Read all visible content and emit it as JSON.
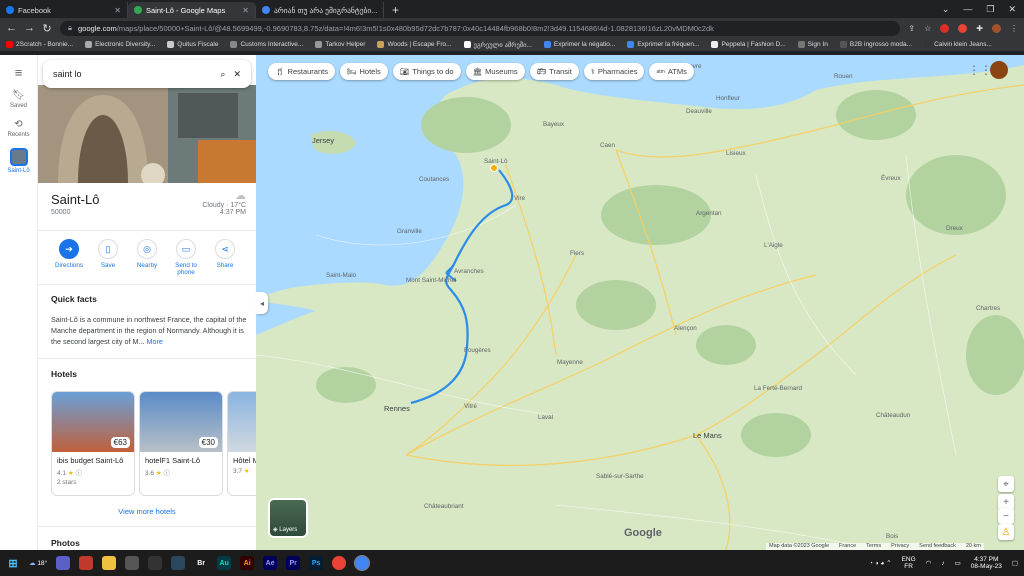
{
  "browser": {
    "tabs": [
      {
        "title": "Facebook",
        "color": "#1877f2"
      },
      {
        "title": "Saint-Lô - Google Maps",
        "color": "#34a853"
      },
      {
        "title": "არიან თუ არა ემიგრანტები...",
        "color": "#4285f4"
      }
    ],
    "new_tab": "+",
    "url_host": "google.com",
    "url_path": "/maps/place/50000+Saint-Lô/@48.5699499,-0.9690783,8.75z/data=!4m6!3m5!1s0x480b95d72dc7b787:0x40c14484fb968b0!8m2!3d49.1154686!4d-1.0828136!16zL20vMDM0c2dk",
    "bookmarks": [
      "2Scratch - Bonnie...",
      "Electronic Diversity...",
      "Quitus Fiscale",
      "Customs Interactive...",
      "Tarkov Helper",
      "Woods | Escape Fro...",
      "ეგრეული ამრეში...",
      "Exprimer la négatio...",
      "Exprimer la fréquen...",
      "Peppela | Fashion D...",
      "Sign In",
      "B2B ingrosso moda...",
      "Calvin klein Jeans..."
    ]
  },
  "rail": {
    "menu_icon": "≡",
    "items": [
      {
        "label": "Saved"
      },
      {
        "label": "Recents"
      },
      {
        "label": "Saint-Lô"
      }
    ]
  },
  "search": {
    "query": "saint lo"
  },
  "place": {
    "name": "Saint-Lô",
    "postal": "50000",
    "weather": "Cloudy · 17°C",
    "time": "4:37 PM",
    "actions": [
      "Directions",
      "Save",
      "Nearby",
      "Send to phone",
      "Share"
    ],
    "quick_facts_title": "Quick facts",
    "quick_facts": "Saint-Lô is a commune in northwest France, the capital of the Manche department in the region of Normandy. Although it is the second largest city of M...",
    "more": "More",
    "hotels_title": "Hotels",
    "hotels": [
      {
        "name": "ibis budget Saint-Lô",
        "rating": "4.1",
        "stars_text": "2 stars",
        "price": "€63"
      },
      {
        "name": "hotelF1 Saint-Lô",
        "rating": "3.6",
        "stars_text": "",
        "price": "€30"
      },
      {
        "name": "Hôtel M",
        "rating": "3.7",
        "stars_text": "",
        "price": ""
      }
    ],
    "view_more": "View more hotels",
    "photos_title": "Photos"
  },
  "chips": [
    "Restaurants",
    "Hotels",
    "Things to do",
    "Museums",
    "Transit",
    "Pharmacies",
    "ATMs"
  ],
  "map_labels": [
    "Jersey",
    "Saint-Lô",
    "Caen",
    "Rouen",
    "Le Havre",
    "Bayeux",
    "Coutances",
    "Granville",
    "Saint-Malo",
    "Mont Saint-Michel",
    "Avranches",
    "Fougères",
    "Rennes",
    "Vitré",
    "Laval",
    "Mayenne",
    "Alençon",
    "Le Mans",
    "L'Aigle",
    "Flers",
    "Évreux",
    "La Ferté-Bernard",
    "Châteaudun",
    "Sablé-sur-Sarthe",
    "Châteaubriant",
    "Dreux",
    "Chartres",
    "Honfleur",
    "Deauville",
    "Lisieux",
    "Argentan",
    "Vire",
    "Bois"
  ],
  "map_footer": [
    "Map data ©2023 Google",
    "France",
    "Terms",
    "Privacy",
    "Send feedback",
    "20 km"
  ],
  "layers_label": "Layers",
  "google_logo": "Google",
  "taskbar": {
    "weather": "18°",
    "lang": "ENG",
    "region": "FR",
    "time": "4:37 PM",
    "date": "08-May-23",
    "apps": [
      "Br",
      "Au",
      "Ai",
      "Ae",
      "Pr",
      "Ps"
    ]
  },
  "colors": {
    "route": "#2b8be8",
    "water": "#aadaff",
    "land": "#d8e8c4",
    "forest": "#b2d39f",
    "accent": "#1a73e8"
  }
}
